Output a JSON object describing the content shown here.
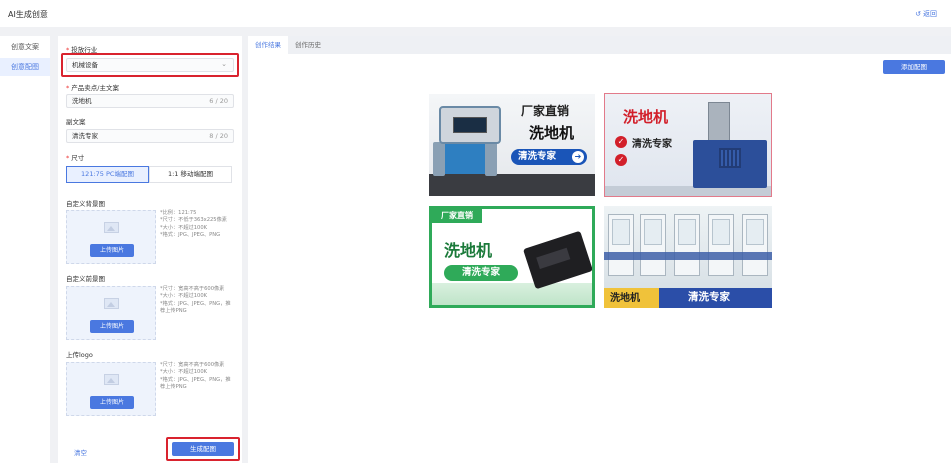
{
  "app": {
    "title": "AI生成创意",
    "back_label": "返回"
  },
  "nav": {
    "items": [
      {
        "label": "创意文案",
        "active": false
      },
      {
        "label": "创意配图",
        "active": true
      }
    ]
  },
  "form": {
    "industry": {
      "label": "投放行业",
      "value": "机械设备"
    },
    "product": {
      "label": "产品卖点/主文案",
      "value": "洗地机",
      "count": "6 / 20"
    },
    "subcopy": {
      "label": "副文案",
      "value": "清洗专家",
      "count": "8 / 20"
    },
    "size": {
      "label": "尺寸",
      "options": [
        {
          "label": "121:75 PC端配图",
          "active": true
        },
        {
          "label": "1:1 移动端配图",
          "active": false
        }
      ]
    },
    "background": {
      "label": "自定义背景图",
      "button": "上传图片",
      "hints": [
        "*比例：121:75",
        "*尺寸：不低于363x225像素",
        "*大小：不超过100K",
        "*格式：JPG、JPEG、PNG"
      ]
    },
    "foreground": {
      "label": "自定义前景图",
      "button": "上传图片",
      "hints": [
        "*尺寸：宽高不高于600像素",
        "*大小：不超过100K",
        "*格式：JPG、JPEG、PNG，推",
        "荐上传PNG"
      ]
    },
    "logo": {
      "label": "上传logo",
      "button": "上传图片",
      "hints": [
        "*尺寸：宽高不高于600像素",
        "*大小：不超过100K",
        "*格式：JPG、JPEG、PNG，推",
        "荐上传PNG"
      ]
    },
    "clear_label": "清空",
    "generate_label": "生成配图"
  },
  "main": {
    "tabs": [
      {
        "label": "创作结果",
        "active": true
      },
      {
        "label": "创作历史",
        "active": false
      }
    ],
    "add_label": "添加配图",
    "cards": [
      {
        "tag": "厂家直销",
        "title": "洗地机",
        "badge": "清洗专家",
        "arrow": "➔"
      },
      {
        "title": "洗地机",
        "sub": "清洗专家",
        "check": "✓"
      },
      {
        "tag": "厂家直销",
        "title": "洗地机",
        "badge": "清洗专家"
      },
      {
        "left": "洗地机",
        "right": "清洗专家"
      }
    ]
  },
  "colors": {
    "accent": "#4a78e0",
    "highlight": "#d9232e"
  }
}
